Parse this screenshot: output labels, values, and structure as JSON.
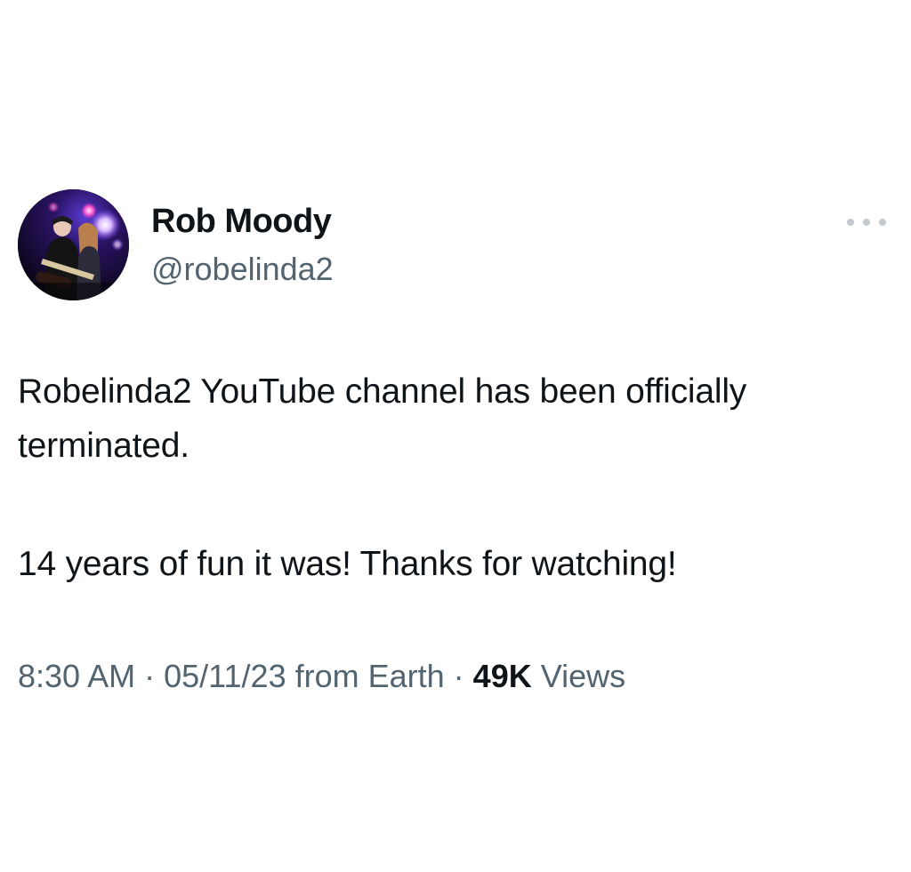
{
  "author": {
    "name": "Rob Moody",
    "handle": "@robelinda2"
  },
  "icons": {
    "more": "more-horizontal-icon",
    "avatar": "profile-avatar"
  },
  "tweet": {
    "paragraphs": [
      "Robelinda2 YouTube channel has been officially terminated.",
      "14 years of fun it was! Thanks for watching!"
    ]
  },
  "meta": {
    "time": "8:30 AM",
    "separator": "·",
    "date_source": "05/11/23 from Earth",
    "views_count": "49K",
    "views_label": "Views"
  },
  "colors": {
    "text_primary": "#0f1419",
    "text_secondary": "#536471",
    "background": "#ffffff"
  }
}
